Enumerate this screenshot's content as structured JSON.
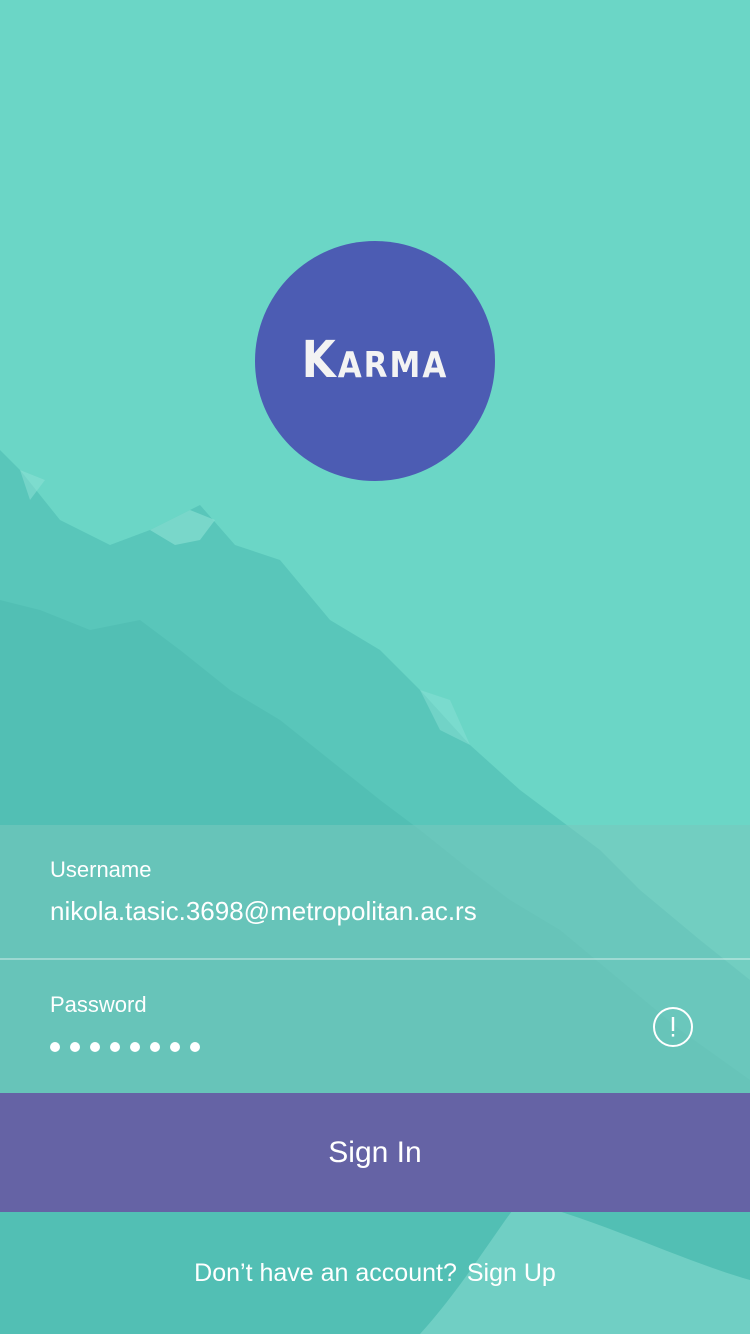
{
  "colors": {
    "background": "#6bd6c6",
    "logo_circle": "#4c5cb3",
    "signin_button": "#6563a5",
    "text": "#ffffff"
  },
  "logo": {
    "text": "Karma"
  },
  "login_form": {
    "username": {
      "label": "Username",
      "value": "nikola.tasic.3698@metropolitan.ac.rs"
    },
    "password": {
      "label": "Password",
      "masked_length": 8,
      "status_icon": "alert-circle-icon"
    }
  },
  "signin_button": {
    "label": "Sign In"
  },
  "footer": {
    "prompt": "Don’t have an account?",
    "signup_link": "Sign Up"
  }
}
